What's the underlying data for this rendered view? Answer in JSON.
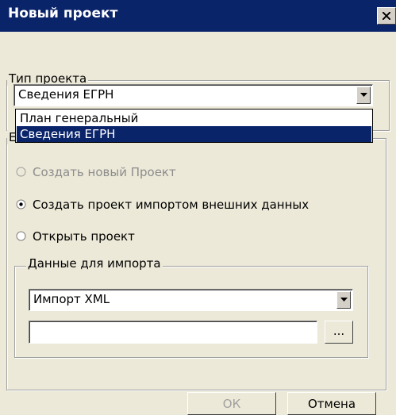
{
  "window": {
    "title": "Новый проект"
  },
  "project_type": {
    "legend": "Тип проекта",
    "selected": "Сведения ЕГРН",
    "options": [
      "План генеральный",
      "Сведения ЕГРН"
    ]
  },
  "mode_group": {
    "legend_partial": "Е",
    "options": [
      {
        "label": "Создать новый Проект",
        "enabled": false,
        "checked": false
      },
      {
        "label": "Создать проект импортом внешних данных",
        "enabled": true,
        "checked": true
      },
      {
        "label": "Открыть проект",
        "enabled": true,
        "checked": false
      }
    ]
  },
  "import_data": {
    "legend": "Данные для импорта",
    "selected": "Импорт XML",
    "path_value": "",
    "browse_label": "..."
  },
  "buttons": {
    "ok_label": "ОК",
    "cancel_label": "Отмена"
  },
  "colors": {
    "titlebar": "#0a246a",
    "face": "#ece9d8",
    "highlight": "#0a246a"
  }
}
